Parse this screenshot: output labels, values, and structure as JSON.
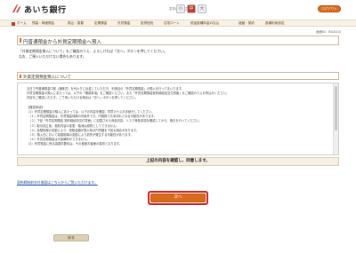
{
  "header": {
    "logo_text": "あいち銀行",
    "fontsize_label": "文字の大きさ",
    "fontsize_small": "小",
    "fontsize_mid": "中",
    "fontsize_large": "大",
    "logout_label": "ログアウト"
  },
  "nav": {
    "items": [
      "ホーム",
      "残高・明細照会",
      "振込・振替",
      "定期預金",
      "外貨預金",
      "投資信託",
      "住宅ローン",
      "税金各種料金の払込",
      "諸届・契約",
      "各種利用設定"
    ]
  },
  "screen_id": "画面ID：BGA010",
  "page_title": "円普通預金から外貨定期預金へ預入",
  "intro": {
    "line1": "「外貨定期預金預入について」をご確認のうえ、よろしければ「次へ」ボタンを押してください。",
    "line2": "なお、ご預入いただけない場合もあります。"
  },
  "section_title": "外貨定期預金預入について",
  "terms": {
    "lines": [
      "当日で円普通預金口座（通帳式）を代わりに出金していただき、利用目の「外貨定期預金」の預入を行ってまいります。",
      "外貨定期預金の預入にあたっては、以下の「確認事項」をご確認ください。また「外貨定期預金契約締結前交付書面」をご確認のうえお申込みください。",
      "内容をご確認いただき、ご了承いただける場合は「次へ」ボタンを押してください。",
      "",
      "【確認事項】",
      "（1）外貨定期預金の預入にあたっては、以下の内容を確認、同意のうえお手続きしてください。",
      "　（１）外貨定期預金は、外貨預金保険の対象外です。円換算で元本割れとなる可能性があります。",
      "　（２）下記「外貨定期預金 契約締結前交付書面」に記載された商品内容、リスク等各事項を確認してから、取引を行ってください。",
      "　（３）取引成立後、契約内容の変更・取消は原則としてできません。",
      "　（４）為替相場の変動により、受取金額が預入時の円貨額を下回る場合があります。",
      "　（５）預入日において為替相場の変動により損失が発生する可能性があります。",
      "　（６）外貨定期預金は中途解約ができません。",
      "（2）外貨預金に係る為替手数料は、その都度お客様の負担となります。"
    ]
  },
  "confirm_text": "上記の内容を確認し、同意します。",
  "pdf_link": "契約締結前交付書面はこちらからご覧いただけます。",
  "next_label": "次へ",
  "back_label": "戻る",
  "colors": {
    "accent": "#d96b1c",
    "brand_red": "#c0392b",
    "highlight": "#d21f1f"
  }
}
